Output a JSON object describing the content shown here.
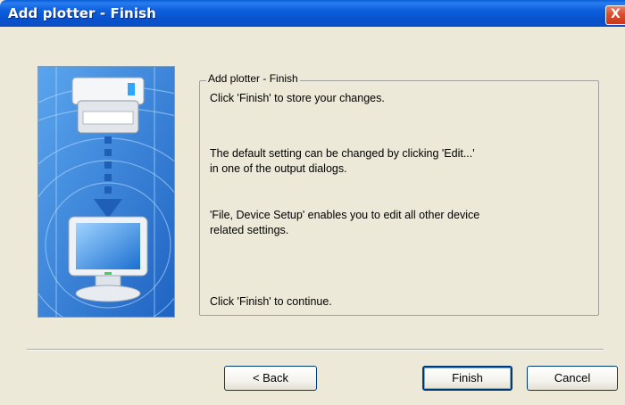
{
  "window": {
    "title": "Add plotter - Finish",
    "close_glyph": "X"
  },
  "illustration": {
    "icon": "printer-to-monitor-illustration"
  },
  "group": {
    "legend": "Add plotter - Finish",
    "lines": [
      "Click 'Finish' to store your changes.",
      "The default setting can be changed by clicking 'Edit...'",
      "in one of the output dialogs.",
      "'File, Device Setup' enables you to edit all other device",
      "related settings.",
      "Click 'Finish' to continue."
    ]
  },
  "buttons": {
    "back": "< Back",
    "finish": "Finish",
    "cancel": "Cancel"
  },
  "colors": {
    "titlebar": "#0a5fd8",
    "dialog_background": "#ece9d8",
    "close_button": "#d84f2f"
  }
}
